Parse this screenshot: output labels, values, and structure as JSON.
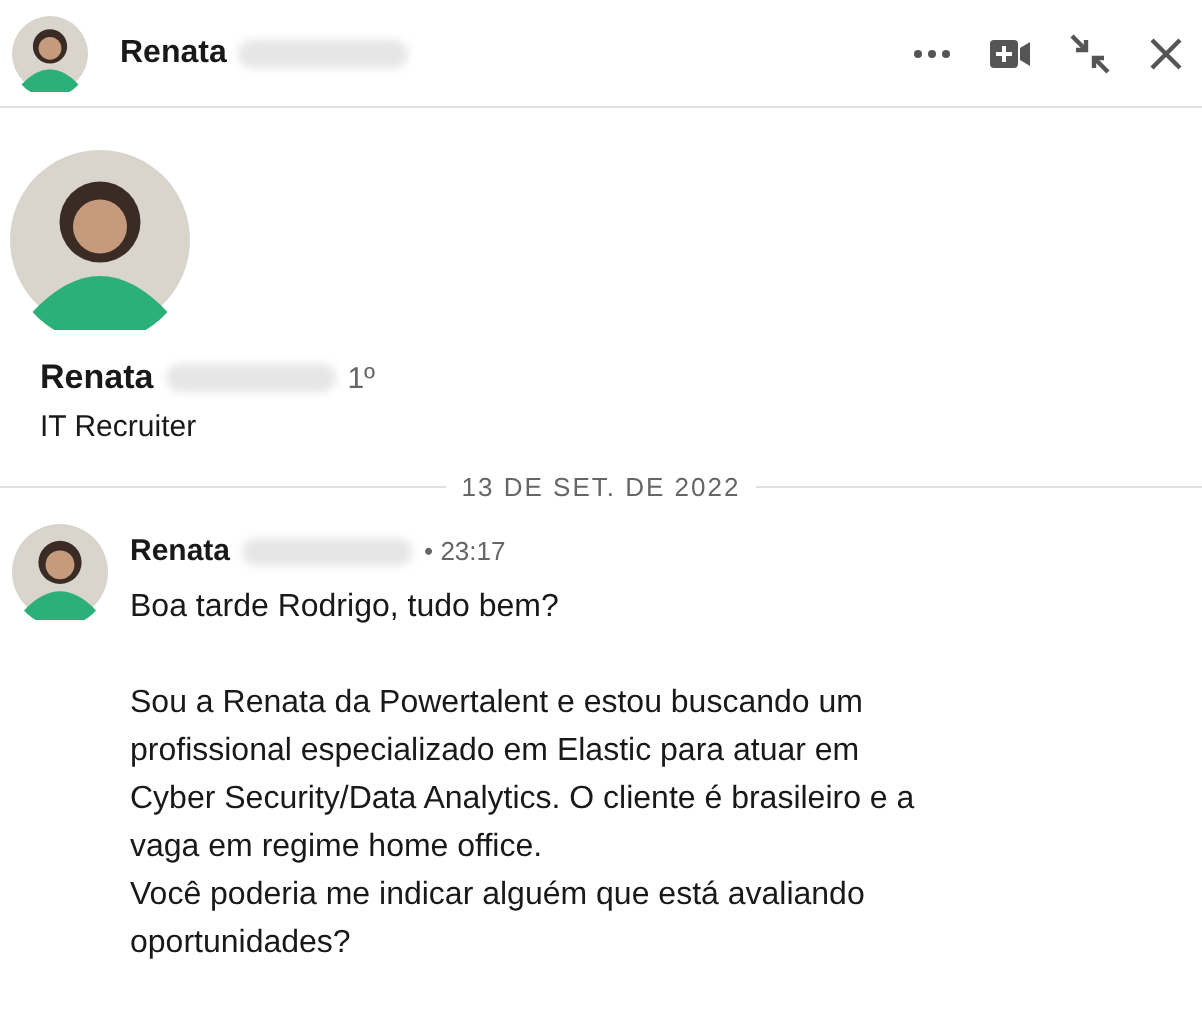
{
  "header": {
    "name": "Renata"
  },
  "profile": {
    "name": "Renata",
    "degree": "1º",
    "headline": "IT Recruiter"
  },
  "date_divider": "13 DE SET. DE 2022",
  "messages": [
    {
      "sender": "Renata",
      "time": "• 23:17",
      "paragraphs": [
        "Boa tarde Rodrigo, tudo bem?",
        "Sou a Renata da Powertalent e estou buscando um profissional especializado em Elastic para atuar em Cyber Security/Data Analytics. O cliente é brasileiro e a vaga em regime home office.\nVocê poderia me indicar alguém que está avaliando oportunidades?"
      ]
    }
  ]
}
